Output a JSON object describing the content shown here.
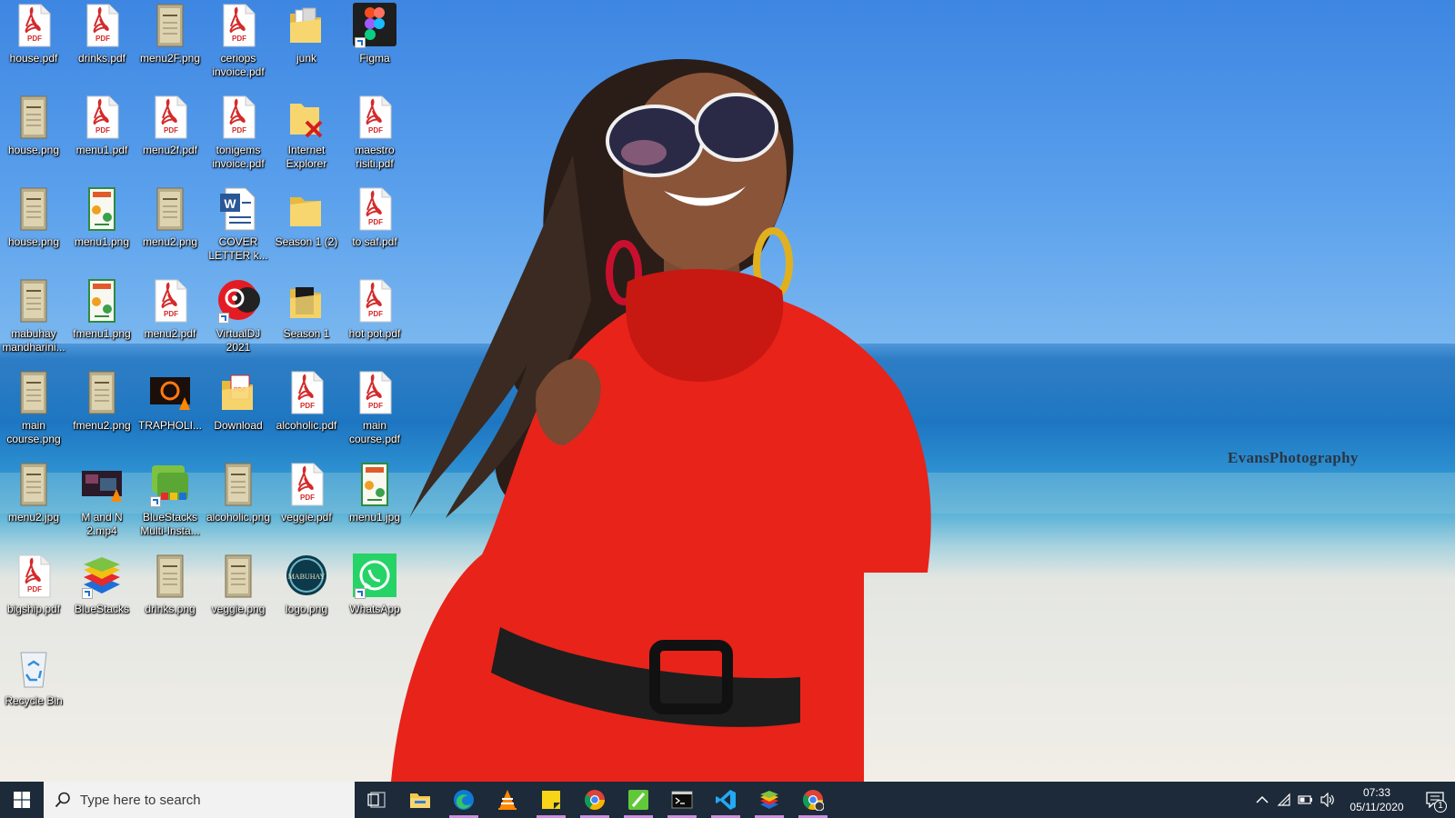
{
  "desktop": {
    "icons": [
      {
        "label": "house.pdf",
        "type": "pdf"
      },
      {
        "label": "drinks.pdf",
        "type": "pdf"
      },
      {
        "label": "menu2F.png",
        "type": "menu-image"
      },
      {
        "label": "ceriops invoice.pdf",
        "type": "pdf"
      },
      {
        "label": "junk",
        "type": "folder-docs"
      },
      {
        "label": "Figma",
        "type": "figma",
        "shortcut": true
      },
      {
        "label": "house.png",
        "type": "menu-image"
      },
      {
        "label": "menu1.pdf",
        "type": "pdf"
      },
      {
        "label": "menu2f.pdf",
        "type": "pdf"
      },
      {
        "label": "tonigems invoice.pdf",
        "type": "pdf"
      },
      {
        "label": "Internet Explorer",
        "type": "ie-broken",
        "shortcut": false
      },
      {
        "label": "maestro risiti.pdf",
        "type": "pdf"
      },
      {
        "label": "house.png",
        "type": "menu-image"
      },
      {
        "label": "menu1.png",
        "type": "menu-color"
      },
      {
        "label": "menu2.png",
        "type": "menu-image"
      },
      {
        "label": "COVER LETTER k...",
        "type": "word"
      },
      {
        "label": "Season 1 (2)",
        "type": "folder"
      },
      {
        "label": "to saf.pdf",
        "type": "pdf"
      },
      {
        "label": "mabuhay mandharini...",
        "type": "menu-image"
      },
      {
        "label": "fmenu1.png",
        "type": "menu-color"
      },
      {
        "label": "menu2.pdf",
        "type": "pdf"
      },
      {
        "label": "VirtualDJ 2021",
        "type": "virtualdj",
        "shortcut": true
      },
      {
        "label": "Season 1",
        "type": "folder-dark"
      },
      {
        "label": "hot pot.pdf",
        "type": "pdf"
      },
      {
        "label": "main course.png",
        "type": "menu-image"
      },
      {
        "label": "fmenu2.png",
        "type": "menu-image"
      },
      {
        "label": "TRAPHOLI...",
        "type": "video-orange"
      },
      {
        "label": "Download",
        "type": "folder-pdf"
      },
      {
        "label": "alcoholic.pdf",
        "type": "pdf"
      },
      {
        "label": "main course.pdf",
        "type": "pdf"
      },
      {
        "label": "menu2.jpg",
        "type": "menu-image"
      },
      {
        "label": "M and N 2.mp4",
        "type": "video-dark"
      },
      {
        "label": "BlueStacks Multi-Insta...",
        "type": "bluestacks-multi",
        "shortcut": true
      },
      {
        "label": "alcoholic.png",
        "type": "menu-image"
      },
      {
        "label": "veggie.pdf",
        "type": "pdf"
      },
      {
        "label": "menu1.jpg",
        "type": "menu-color"
      },
      {
        "label": "bigship.pdf",
        "type": "pdf"
      },
      {
        "label": "BlueStacks",
        "type": "bluestacks",
        "shortcut": true
      },
      {
        "label": "drinks.png",
        "type": "menu-image"
      },
      {
        "label": "veggie.png",
        "type": "menu-image"
      },
      {
        "label": "logo.png",
        "type": "logo"
      },
      {
        "label": "WhatsApp",
        "type": "whatsapp",
        "shortcut": true
      },
      {
        "label": "Recycle Bin",
        "type": "recycle-bin"
      }
    ]
  },
  "wallpaper": {
    "watermark": "EvansPhotography"
  },
  "taskbar": {
    "search_placeholder": "Type here to search",
    "apps": [
      {
        "name": "task-view",
        "running": false
      },
      {
        "name": "file-explorer",
        "running": false
      },
      {
        "name": "edge",
        "running": true
      },
      {
        "name": "vlc",
        "running": false
      },
      {
        "name": "sticky-notes",
        "running": true
      },
      {
        "name": "chrome",
        "running": true
      },
      {
        "name": "notepad-plus",
        "running": true
      },
      {
        "name": "command-prompt",
        "running": true
      },
      {
        "name": "vscode",
        "running": true
      },
      {
        "name": "bluestacks",
        "running": true
      },
      {
        "name": "chrome-profile",
        "running": true
      }
    ],
    "tray": {
      "time": "07:33",
      "date": "05/11/2020",
      "notifications": "1"
    }
  },
  "colors": {
    "taskbar_bg": "#1c2a39",
    "pdf_red": "#d42a2a",
    "dress_red": "#e8231a"
  }
}
